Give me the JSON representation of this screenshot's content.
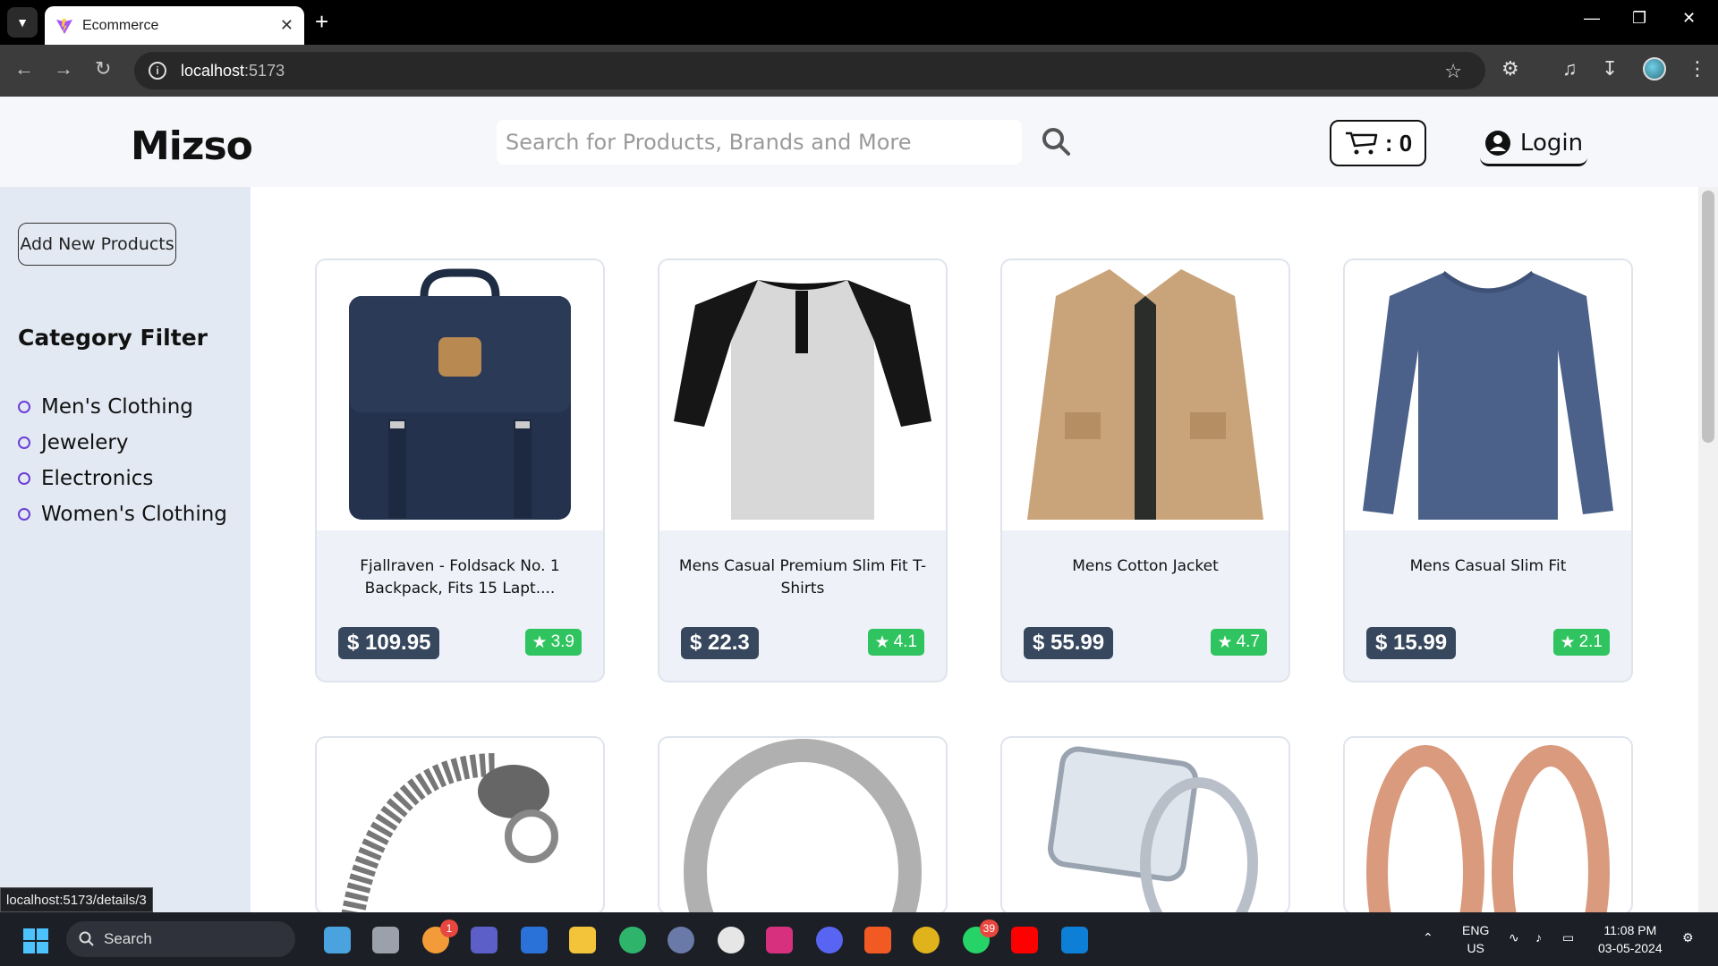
{
  "browser": {
    "tab_title": "Ecommerce",
    "url_host": "localhost",
    "url_port": ":5173",
    "status_url": "localhost:5173/details/3"
  },
  "header": {
    "logo": "Mizso",
    "search_placeholder": "Search for Products, Brands and More",
    "cart_count": ": 0",
    "login_label": "Login"
  },
  "sidebar": {
    "add_button": "Add New Products",
    "filter_title": "Category Filter",
    "categories": [
      "Men's Clothing",
      "Jewelery",
      "Electronics",
      "Women's Clothing"
    ]
  },
  "products": [
    {
      "title": "Fjallraven - Foldsack No. 1 Backpack, Fits 15 Lapt....",
      "price": "$ 109.95",
      "rating": "3.9",
      "image": "backpack"
    },
    {
      "title": "Mens Casual Premium Slim Fit T-Shirts",
      "price": "$ 22.3",
      "rating": "4.1",
      "image": "henley-tshirt"
    },
    {
      "title": "Mens Cotton Jacket",
      "price": "$ 55.99",
      "rating": "4.7",
      "image": "cotton-jacket"
    },
    {
      "title": "Mens Casual Slim Fit",
      "price": "$ 15.99",
      "rating": "2.1",
      "image": "long-sleeve-shirt"
    },
    {
      "image": "dragon-bracelet"
    },
    {
      "image": "silver-ring"
    },
    {
      "image": "diamond-ring"
    },
    {
      "image": "rose-gold-rings"
    }
  ],
  "taskbar": {
    "search_label": "Search",
    "lang_top": "ENG",
    "lang_bottom": "US",
    "time": "11:08 PM",
    "date": "03-05-2024",
    "badge_a": "1",
    "badge_b": "39"
  },
  "colors": {
    "price_bg": "#37475e",
    "rating_bg": "#2fc45f",
    "sidebar_bg": "#e3e9f3",
    "radio": "#6b3fd6"
  }
}
